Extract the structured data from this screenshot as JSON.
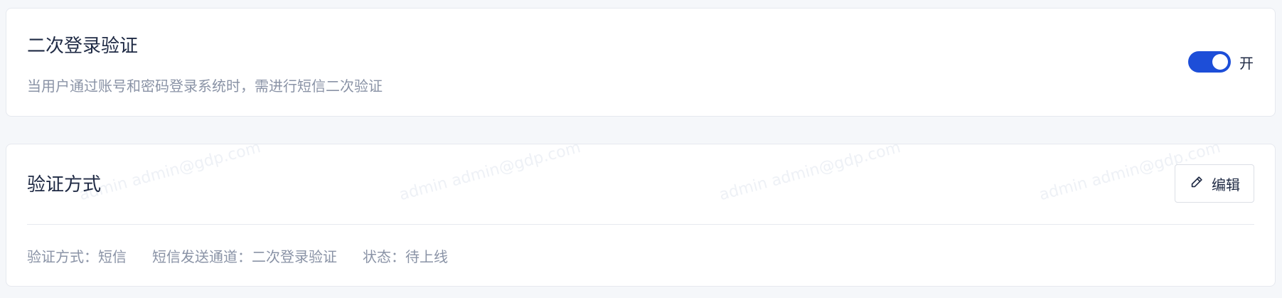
{
  "two_factor": {
    "title": "二次登录验证",
    "description": "当用户通过账号和密码登录系统时，需进行短信二次验证",
    "toggle_state": "on",
    "toggle_label": "开"
  },
  "verification_method": {
    "title": "验证方式",
    "edit_label": "编辑",
    "details": [
      "验证方式：短信",
      "短信发送通道：二次登录验证",
      "状态：待上线"
    ]
  },
  "watermark": {
    "text": "admin admin@gdp.com"
  },
  "colors": {
    "accent": "#1d4ed8",
    "background": "#f5f7fa",
    "card": "#ffffff",
    "text_primary": "#1f2a44",
    "text_secondary": "#8a93a6"
  },
  "icons": {
    "edit": "pencil-icon"
  }
}
